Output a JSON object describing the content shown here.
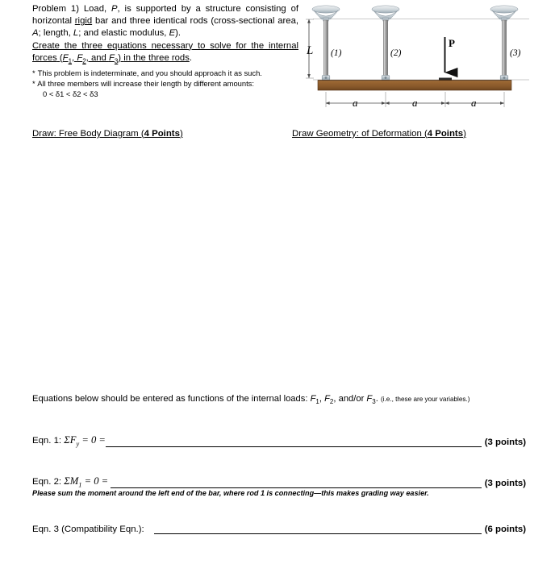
{
  "document": {
    "title": "Problem 1 - Indeterminate Axial Structure Worksheet"
  },
  "problem": {
    "body_segments": {
      "s1": "Problem 1) Load, ",
      "s2": "P",
      "s3": ", is supported by a structure consisting of horizontal ",
      "s4": "rigid",
      "s5": " bar and three identical rods (cross-sectional area, ",
      "s6": "A",
      "s7": "; length, ",
      "s8": "L",
      "s9": "; and elastic modulus, ",
      "s10": "E",
      "s11": ").",
      "s12": "Create the three equations necessary to solve for the internal forces",
      "s13": "F",
      "s14": "1",
      "s15": ", ",
      "s16": "F",
      "s17": "2",
      "s18": ", and ",
      "s19": "F",
      "s20": "3",
      "s21": "in the three rods",
      "s22": "."
    },
    "note_1": {
      "bullet": "*",
      "text_a": "This problem is ",
      "underlined": "indeterminate",
      "text_b": ", and you should approach it as such."
    },
    "note_2": {
      "bullet": "*",
      "text_a": "All three members will increase their length by ",
      "underlined": "different",
      "text_b": " amounts:"
    },
    "inequality": "0 < δ1 < δ2 < δ3"
  },
  "figure": {
    "dim_vertical_label": "L",
    "load_label": "P",
    "rod_labels": [
      "(1)",
      "(2)",
      "(3)"
    ],
    "span_labels": [
      "a",
      "a",
      "a"
    ],
    "colors": {
      "bar_face": "#8a5a2b",
      "bar_top": "#5c3a1b",
      "rod_body": "#9c9c9c",
      "rod_highlight": "#d8d8d8",
      "cap_fill": "#c6ced4",
      "cap_top": "#e8eaec",
      "bracket": "#a8b4bc",
      "dim_line": "#6b6b6b",
      "arrow": "#1a1a1a"
    }
  },
  "draw_sections": [
    {
      "label_main": "Draw: Free Body Diagram (",
      "label_points": "4 Points",
      "label_close": ")"
    },
    {
      "label_main": "Draw Geometry: of Deformation (",
      "label_points": "4 Points",
      "label_close": ")"
    }
  ],
  "equations_intro": {
    "main": "Equations below should be entered as functions of the internal loads: ",
    "var1": "F",
    "var1_sub": "1",
    "sep1": ", ",
    "var2": "F",
    "var2_sub": "2",
    "sep2": ", and/or ",
    "var3": "F",
    "var3_sub": "3",
    "period": ".",
    "parenthetical": "(i.e., these are your variables.)"
  },
  "equations": [
    {
      "prefix": "Eqn. 1: ",
      "sigma": "ΣF",
      "sub": "y",
      "suffix": " = 0 =",
      "points": "(3 points)",
      "subnote": ""
    },
    {
      "prefix": "Eqn. 2: ",
      "sigma": "ΣM",
      "sub": "1",
      "suffix": " = 0 =",
      "points": "(3 points)",
      "subnote": "Please sum the moment around the left end of the bar, where rod 1 is connecting—this makes grading way easier."
    },
    {
      "prefix": "Eqn. 3 (Compatibility Eqn.):",
      "sigma": "",
      "sub": "",
      "suffix": "",
      "points": "(6 points)",
      "subnote": ""
    }
  ]
}
